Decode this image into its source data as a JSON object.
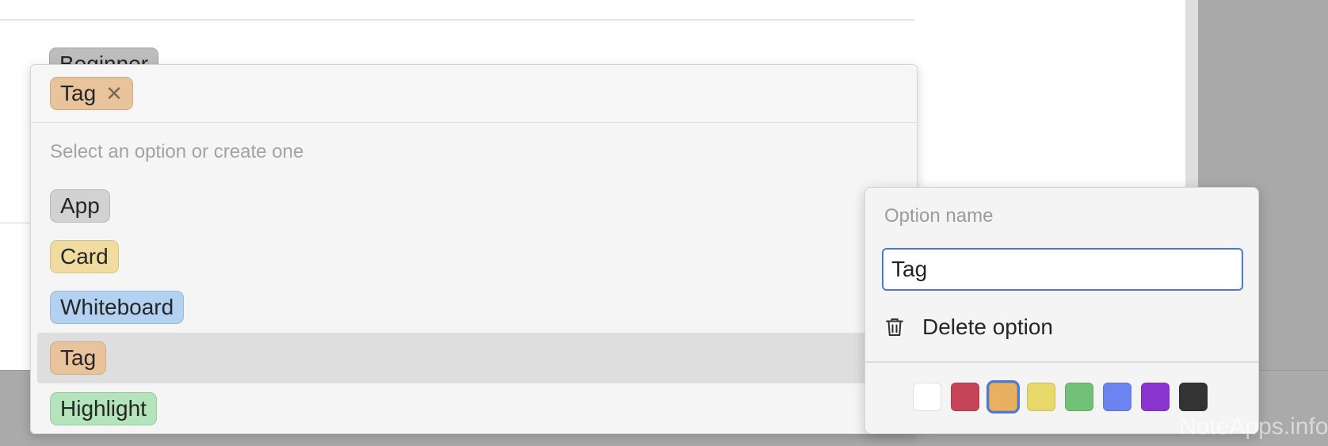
{
  "background": {
    "chip": {
      "label": "Beginner",
      "color": "#bdbdbd"
    }
  },
  "dropdown": {
    "selected_chip": {
      "label": "Tag",
      "remove_icon": "close-icon",
      "color": "#e8c39c"
    },
    "hint": "Select an option or create one",
    "options": [
      {
        "label": "App",
        "color": "#d2d2d2"
      },
      {
        "label": "Card",
        "color": "#f1dca0"
      },
      {
        "label": "Whiteboard",
        "color": "#b3d2f1"
      },
      {
        "label": "Tag",
        "color": "#e8c39c"
      },
      {
        "label": "Highlight",
        "color": "#b3e4ba"
      }
    ],
    "selected_index": 3
  },
  "option_editor": {
    "label": "Option name",
    "value": "Tag",
    "delete_label": "Delete option",
    "delete_icon": "trash-icon",
    "colors": [
      "#ffffff",
      "#c64458",
      "#e9b062",
      "#e8d96a",
      "#72c178",
      "#6b84ef",
      "#8a35cf",
      "#333333"
    ],
    "selected_color_index": 2
  },
  "watermark": "NoteApps.info"
}
